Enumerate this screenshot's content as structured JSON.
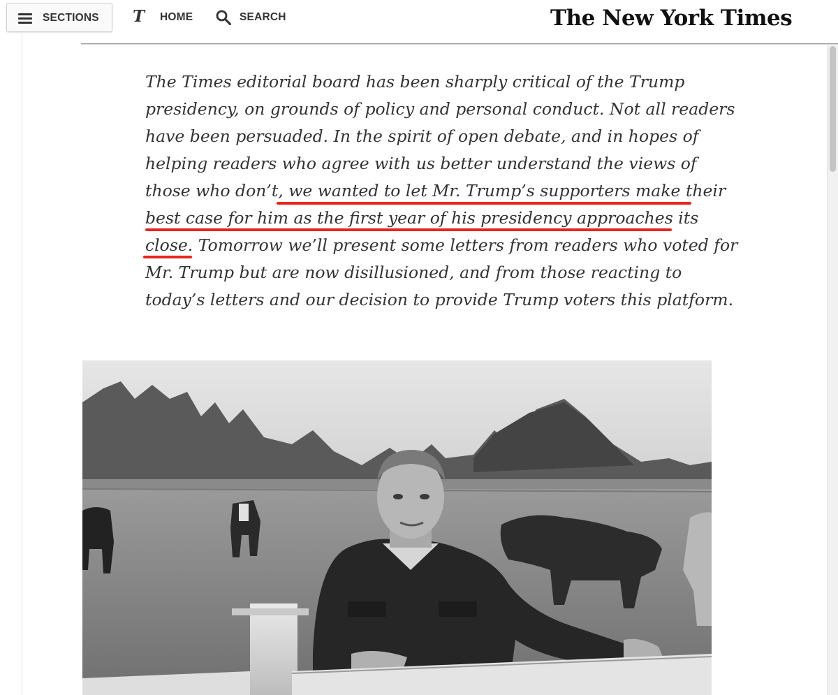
{
  "header": {
    "sections_label": "SECTIONS",
    "home_label": "HOME",
    "search_label": "SEARCH",
    "masthead": "The New York Times",
    "logo_glyph": "T"
  },
  "article": {
    "intro_lines": [
      "The Times editorial board has been sharply critical of the Trump",
      "presidency, on grounds of policy and personal conduct. Not all readers",
      "have been persuaded. In the spirit of open debate, and in hopes of",
      "helping readers who agree with us better understand the views of",
      "those who don’t, we wanted to let Mr. Trump’s supporters make their",
      "best case for him as the first year of his presidency approaches its",
      "close. Tomorrow we’ll present some letters from readers who voted for",
      "Mr. Trump but are now disillusioned, and from those reacting to",
      "today’s letters and our decision to provide Trump voters this platform."
    ],
    "highlight_color": "#e8251f"
  },
  "colors": {
    "text": "#333333",
    "nav_text": "#333333",
    "rule": "#999999"
  },
  "icons": {
    "menu": "hamburger-icon",
    "home": "nyt-t-logo",
    "search": "search-icon"
  }
}
